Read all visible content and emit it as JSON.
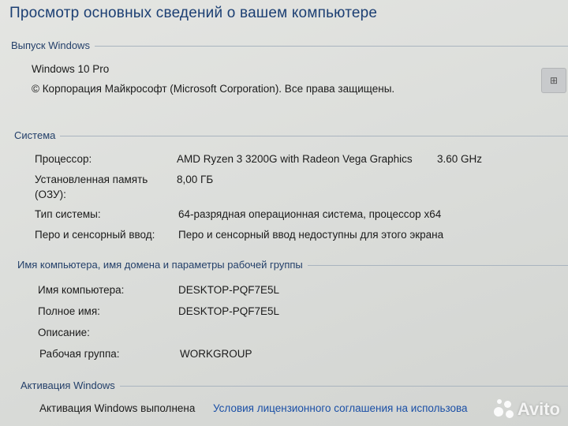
{
  "title": "Просмотр основных сведений о вашем компьютере",
  "edition": {
    "header": "Выпуск Windows",
    "name": "Windows 10 Pro",
    "copyright": "© Корпорация Майкрософт (Microsoft Corporation). Все права защищены."
  },
  "system": {
    "header": "Система",
    "rows": [
      {
        "label": "Процессор:",
        "value": "AMD Ryzen 3 3200G with Radeon Vega Graphics",
        "extra": "3.60 GHz"
      },
      {
        "label": "Установленная память",
        "label2": "(ОЗУ):",
        "value": "8,00 ГБ"
      },
      {
        "label": "Тип системы:",
        "value": "64-разрядная операционная система, процессор x64"
      },
      {
        "label": "Перо и сенсорный ввод:",
        "value": "Перо и сенсорный ввод недоступны для этого экрана"
      }
    ]
  },
  "computer": {
    "header": "Имя компьютера, имя домена и параметры рабочей группы",
    "rows": [
      {
        "label": "Имя компьютера:",
        "value": "DESKTOP-PQF7E5L"
      },
      {
        "label": "Полное имя:",
        "value": "DESKTOP-PQF7E5L"
      },
      {
        "label": "Описание:",
        "value": ""
      },
      {
        "label": "Рабочая группа:",
        "value": "WORKGROUP"
      }
    ]
  },
  "activation": {
    "header": "Активация Windows",
    "status": "Активация Windows выполнена",
    "link": "Условия лицензионного соглашения на использова"
  },
  "watermark": {
    "text": "Avito"
  }
}
